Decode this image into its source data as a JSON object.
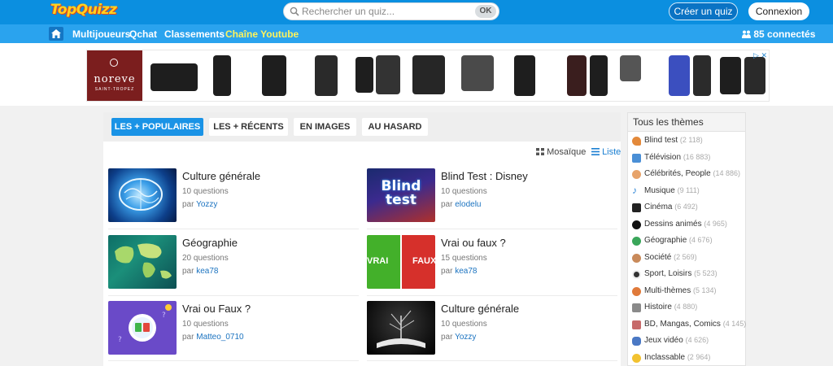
{
  "header": {
    "logo": "TopQuizz",
    "search_placeholder": "Rechercher un quiz...",
    "search_button": "OK",
    "create_button": "Créer un quiz",
    "login_button": "Connexion"
  },
  "nav": {
    "items": [
      "Multijoueurs",
      "Qchat",
      "Classements",
      "Chaîne Youtube"
    ],
    "connected": "85 connectés"
  },
  "ad": {
    "brand": "noreve",
    "brand_sub": "SAINT-TROPEZ",
    "badge": "▷ ✕"
  },
  "tabs": [
    "LES + POPULAIRES",
    "LES + RÉCENTS",
    "EN IMAGES",
    "AU HASARD"
  ],
  "view_modes": [
    "Mosaïque",
    "Liste"
  ],
  "quizzes": [
    {
      "title": "Culture générale",
      "questions": "10 questions",
      "by": "par ",
      "author": "Yozzy",
      "thumb_icon": "brain-image"
    },
    {
      "title": "Blind Test : Disney",
      "questions": "10 questions",
      "by": "par ",
      "author": "elodelu",
      "thumb_icon": "blind-test-image",
      "thumb_text": "Blind test"
    },
    {
      "title": "Géographie",
      "questions": "20 questions",
      "by": "par ",
      "author": "kea78",
      "thumb_icon": "world-map-image"
    },
    {
      "title": "Vrai ou faux ?",
      "questions": "15 questions",
      "by": "par ",
      "author": "kea78",
      "thumb_icon": "vrai-faux-image",
      "thumb_text_left": "VRAI",
      "thumb_text_right": "FAUX"
    },
    {
      "title": "Vrai ou Faux ?",
      "questions": "10 questions",
      "by": "par ",
      "author": "Matteo_0710",
      "thumb_icon": "quiz-badge-image"
    },
    {
      "title": "Culture générale",
      "questions": "10 questions",
      "by": "par ",
      "author": "Yozzy",
      "thumb_icon": "book-tree-image"
    }
  ],
  "sidebar": {
    "title": "Tous les thèmes",
    "themes": [
      {
        "name": "Blind test",
        "count": "(2 118)",
        "icon": "guitar-icon"
      },
      {
        "name": "Télévision",
        "count": "(16 883)",
        "icon": "tv-icon"
      },
      {
        "name": "Célébrités, People",
        "count": "(14 886)",
        "icon": "star-person-icon"
      },
      {
        "name": "Musique",
        "count": "(9 111)",
        "icon": "music-note-icon"
      },
      {
        "name": "Cinéma",
        "count": "(6 492)",
        "icon": "camera-icon"
      },
      {
        "name": "Dessins animés",
        "count": "(4 965)",
        "icon": "mouse-ears-icon"
      },
      {
        "name": "Géographie",
        "count": "(4 676)",
        "icon": "globe-icon"
      },
      {
        "name": "Société",
        "count": "(2 569)",
        "icon": "people-icon"
      },
      {
        "name": "Sport, Loisirs",
        "count": "(5 523)",
        "icon": "soccer-ball-icon"
      },
      {
        "name": "Multi-thèmes",
        "count": "(5 134)",
        "icon": "multi-theme-icon"
      },
      {
        "name": "Histoire",
        "count": "(4 880)",
        "icon": "scroll-icon"
      },
      {
        "name": "BD, Mangas, Comics",
        "count": "(4 145)",
        "icon": "comic-icon"
      },
      {
        "name": "Jeux vidéo",
        "count": "(4 626)",
        "icon": "gamepad-icon"
      },
      {
        "name": "Inclassable",
        "count": "(2 964)",
        "icon": "smiley-icon"
      }
    ]
  },
  "colors": {
    "topbar": "#0b8fe0",
    "navbar": "#2aa3ee",
    "accent": "#1a93e6",
    "link": "#1b73c0"
  }
}
